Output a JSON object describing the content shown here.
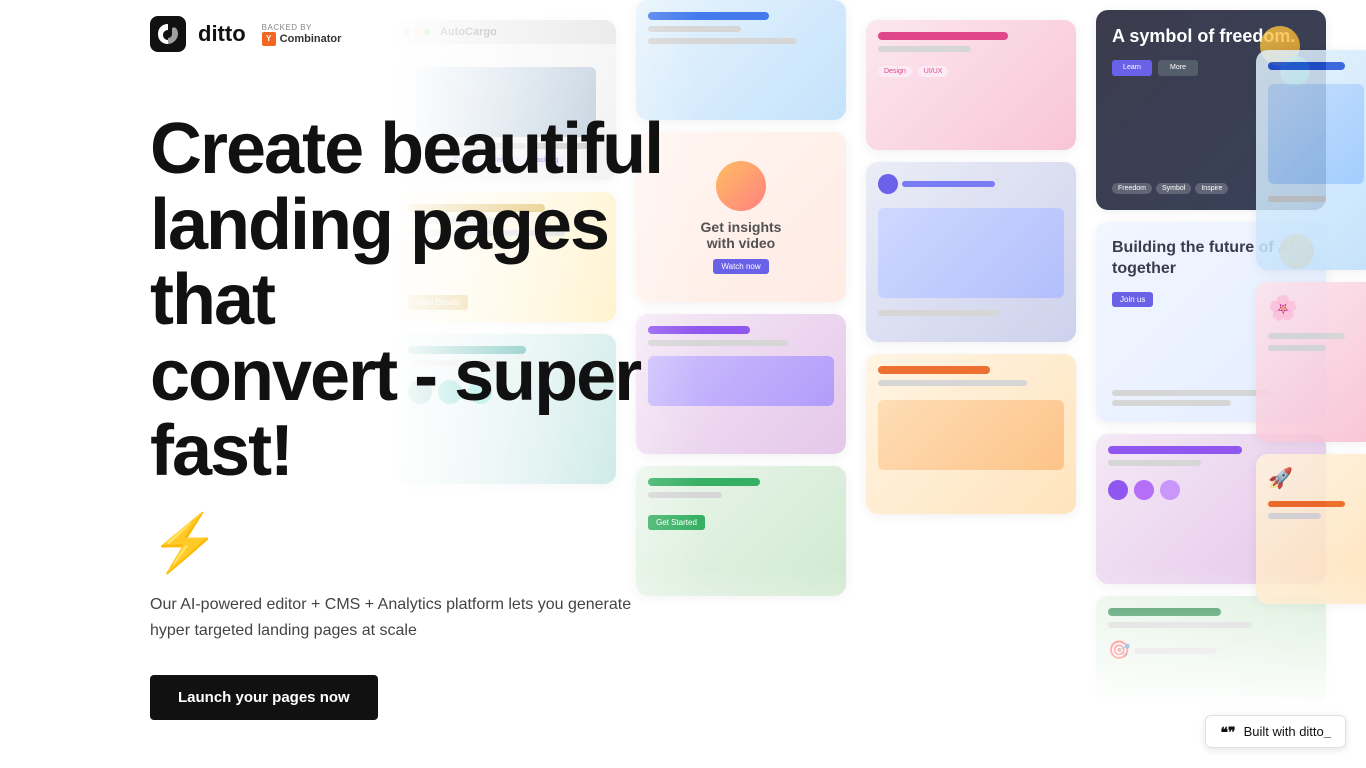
{
  "logo": {
    "icon_alt": "ditto-logo-icon",
    "text": "ditto",
    "yc": {
      "backed_label": "Backed by",
      "combinator_label": "Combinator"
    }
  },
  "hero": {
    "headline_line1": "Create beautiful",
    "headline_line2": "landing pages that",
    "headline_line3": "convert - super fast!",
    "lightning_emoji": "⚡",
    "subheadline": "Our AI-powered editor + CMS + Analytics platform lets you generate hyper targeted landing pages at scale",
    "cta_button_label": "Launch your pages now"
  },
  "mosaic": {
    "cards": [
      {
        "id": "autocargo",
        "title": "AutoCargo"
      },
      {
        "id": "freedom",
        "title": "A symbol of freedom."
      },
      {
        "id": "video-insights",
        "title": "Get insights with video"
      },
      {
        "id": "building-ai",
        "title": "Building the future of AI together"
      }
    ]
  },
  "built_with": {
    "quote_marks": "❝❞",
    "text": "Built with ditto",
    "underscore": "_"
  }
}
